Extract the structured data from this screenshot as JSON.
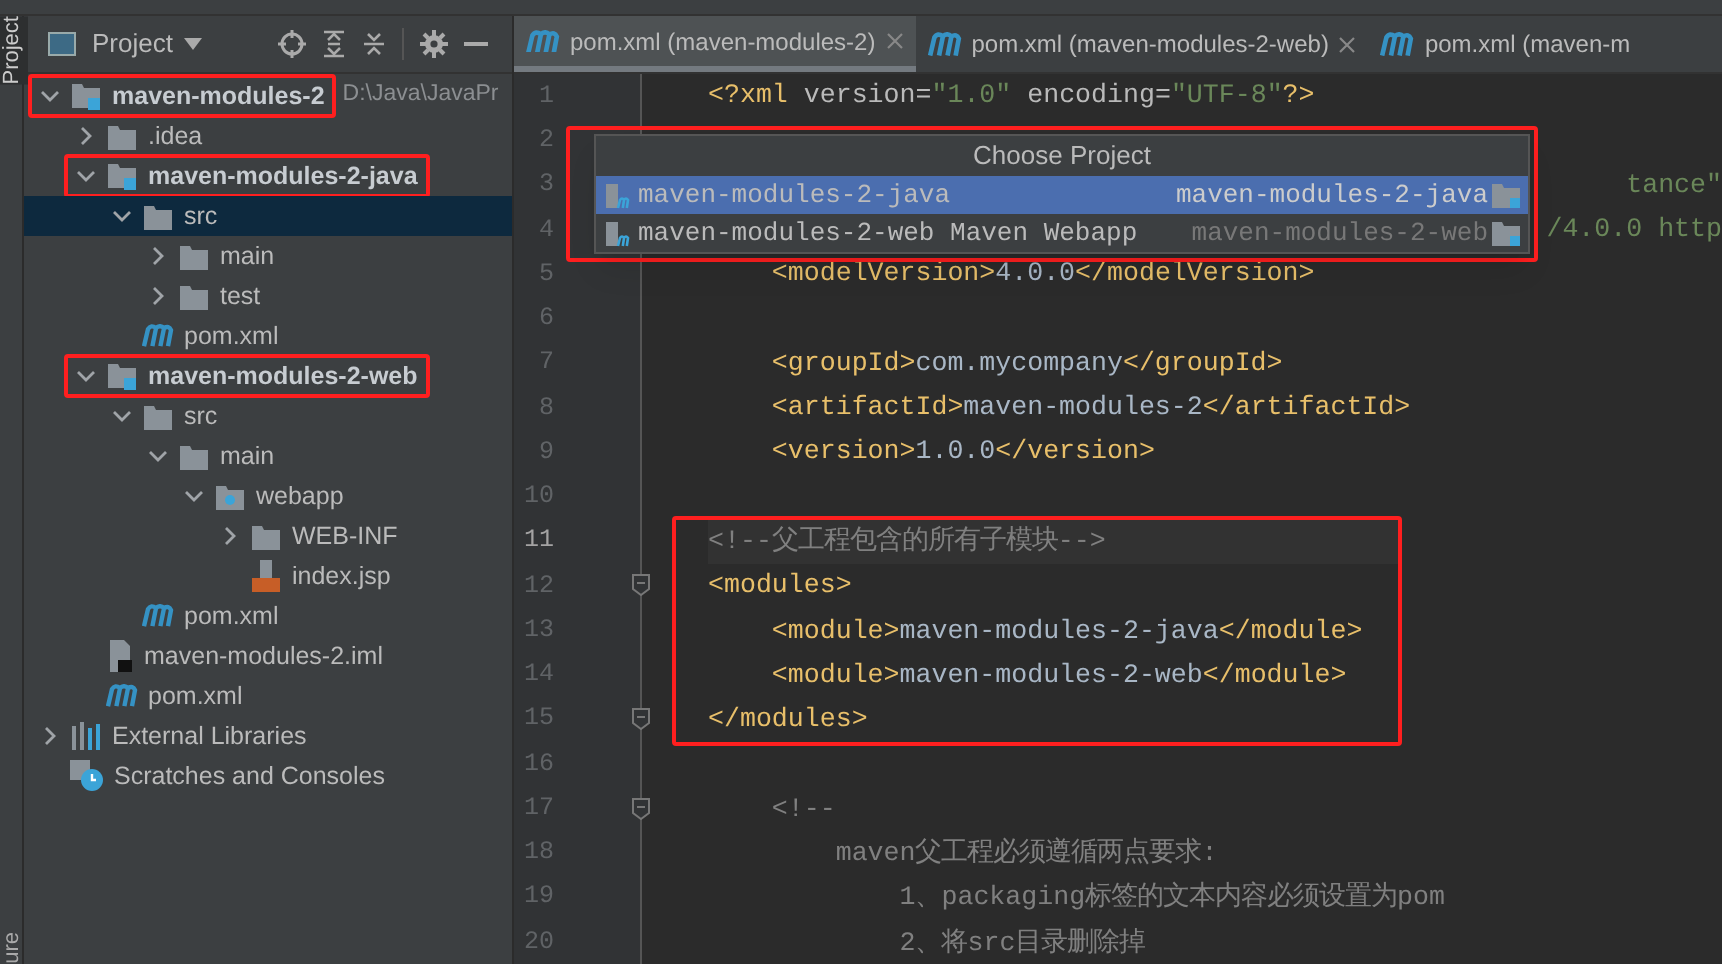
{
  "side_strip": {
    "top_tab": "Project",
    "bottom_tab": "ure"
  },
  "project_panel": {
    "title": "Project",
    "tree": [
      {
        "name": "maven-modules-2",
        "kind": "module",
        "path": "D:\\Java\\JavaPr",
        "expanded": true,
        "selected": false,
        "annotated": true,
        "children": [
          {
            "name": ".idea",
            "kind": "folder",
            "expanded": false,
            "selected": false,
            "annotated": false
          },
          {
            "name": "maven-modules-2-java",
            "kind": "module",
            "expanded": true,
            "selected": false,
            "annotated": true,
            "children": [
              {
                "name": "src",
                "kind": "folder",
                "expanded": true,
                "selected": true,
                "annotated": false,
                "children": [
                  {
                    "name": "main",
                    "kind": "folder",
                    "expanded": false,
                    "selected": false,
                    "annotated": false
                  },
                  {
                    "name": "test",
                    "kind": "folder",
                    "expanded": false,
                    "selected": false,
                    "annotated": false
                  }
                ]
              },
              {
                "name": "pom.xml",
                "kind": "pom",
                "selected": false,
                "annotated": false
              }
            ]
          },
          {
            "name": "maven-modules-2-web",
            "kind": "module",
            "expanded": true,
            "selected": false,
            "annotated": true,
            "children": [
              {
                "name": "src",
                "kind": "folder",
                "expanded": true,
                "selected": false,
                "annotated": false,
                "children": [
                  {
                    "name": "main",
                    "kind": "folder",
                    "expanded": true,
                    "selected": false,
                    "annotated": false,
                    "children": [
                      {
                        "name": "webapp",
                        "kind": "webfolder",
                        "expanded": true,
                        "selected": false,
                        "annotated": false,
                        "children": [
                          {
                            "name": "WEB-INF",
                            "kind": "folder",
                            "expanded": false,
                            "selected": false,
                            "annotated": false
                          },
                          {
                            "name": "index.jsp",
                            "kind": "jsp",
                            "selected": false,
                            "annotated": false
                          }
                        ]
                      }
                    ]
                  }
                ]
              },
              {
                "name": "pom.xml",
                "kind": "pom",
                "selected": false,
                "annotated": false
              }
            ]
          },
          {
            "name": "maven-modules-2.iml",
            "kind": "iml",
            "selected": false,
            "annotated": false
          },
          {
            "name": "pom.xml",
            "kind": "pom",
            "selected": false,
            "annotated": false
          }
        ]
      },
      {
        "name": "External Libraries",
        "kind": "libraries",
        "expanded": false,
        "selected": false,
        "annotated": false
      },
      {
        "name": "Scratches and Consoles",
        "kind": "scratches",
        "selected": false,
        "annotated": false
      }
    ]
  },
  "tabs": [
    {
      "label": "pom.xml (maven-modules-2)",
      "selected": true,
      "closable": true
    },
    {
      "label": "pom.xml (maven-modules-2-web)",
      "selected": false,
      "closable": true
    },
    {
      "label": "pom.xml (maven-m",
      "selected": false,
      "closable": false
    }
  ],
  "editor": {
    "blocks": [
      {
        "annotated": false,
        "lines": [
          {
            "number": "1",
            "fold": false,
            "current": false,
            "segments": [
              {
                "text": "<?xml",
                "kind": "tag"
              },
              {
                "text": " version=",
                "kind": "attr"
              },
              {
                "text": "\"1.0\"",
                "kind": "string"
              },
              {
                "text": " encoding=",
                "kind": "attr"
              },
              {
                "text": "\"UTF-8\"",
                "kind": "string"
              },
              {
                "text": "?>",
                "kind": "tag"
              }
            ]
          },
          {
            "number": "2",
            "fold": false,
            "current": false
          },
          {
            "number": "3",
            "current": false,
            "tail": "tance\""
          },
          {
            "number": "4",
            "current": false,
            "tail": "/4.0.0 http"
          },
          {
            "number": "5",
            "fold": false,
            "current": false,
            "segments": [
              {
                "text": "    <modelVersion>",
                "kind": "tag"
              },
              {
                "text": "4.0.0",
                "kind": "text"
              },
              {
                "text": "</modelVersion>",
                "kind": "tag"
              }
            ]
          },
          {
            "number": "6",
            "fold": false,
            "current": false
          },
          {
            "number": "7",
            "fold": false,
            "current": false,
            "segments": [
              {
                "text": "    <groupId>",
                "kind": "tag"
              },
              {
                "text": "com.mycompany",
                "kind": "text"
              },
              {
                "text": "</groupId>",
                "kind": "tag"
              }
            ]
          },
          {
            "number": "8",
            "fold": false,
            "current": false,
            "segments": [
              {
                "text": "    <artifactId>",
                "kind": "tag"
              },
              {
                "text": "maven-modules-2",
                "kind": "text"
              },
              {
                "text": "</artifactId>",
                "kind": "tag"
              }
            ]
          },
          {
            "number": "9",
            "fold": false,
            "current": false,
            "segments": [
              {
                "text": "    <version>",
                "kind": "tag"
              },
              {
                "text": "1.0.0",
                "kind": "text"
              },
              {
                "text": "</version>",
                "kind": "tag"
              }
            ]
          },
          {
            "number": "10",
            "fold": false,
            "current": false
          }
        ]
      },
      {
        "annotated": true,
        "lines": [
          {
            "number": "11",
            "fold": false,
            "current": true,
            "segments": [
              {
                "text": "<!--父工程包含的所有子模块-->",
                "kind": "comment"
              }
            ]
          },
          {
            "number": "12",
            "fold": true,
            "current": false,
            "segments": [
              {
                "text": "<modules>",
                "kind": "tag"
              }
            ]
          },
          {
            "number": "13",
            "fold": false,
            "current": false,
            "segments": [
              {
                "text": "    <module>",
                "kind": "tag"
              },
              {
                "text": "maven-modules-2-java",
                "kind": "text"
              },
              {
                "text": "</module>",
                "kind": "tag"
              }
            ]
          },
          {
            "number": "14",
            "fold": false,
            "current": false,
            "segments": [
              {
                "text": "    <module>",
                "kind": "tag"
              },
              {
                "text": "maven-modules-2-web",
                "kind": "text"
              },
              {
                "text": "</module>",
                "kind": "tag"
              }
            ]
          },
          {
            "number": "15",
            "fold": true,
            "current": false,
            "segments": [
              {
                "text": "</modules>",
                "kind": "tag"
              }
            ]
          }
        ]
      },
      {
        "annotated": false,
        "lines": [
          {
            "number": "16",
            "fold": false,
            "current": false
          },
          {
            "number": "17",
            "fold": true,
            "current": false,
            "segments": [
              {
                "text": "    <!--",
                "kind": "comment"
              }
            ]
          },
          {
            "number": "18",
            "fold": false,
            "current": false,
            "segments": [
              {
                "text": "        maven父工程必须遵循两点要求:",
                "kind": "comment"
              }
            ]
          },
          {
            "number": "19",
            "fold": false,
            "current": false,
            "segments": [
              {
                "text": "            1、packaging标签的文本内容必须设置为pom",
                "kind": "comment"
              }
            ]
          },
          {
            "number": "20",
            "fold": false,
            "current": false,
            "segments": [
              {
                "text": "            2、将src目录删除掉",
                "kind": "comment"
              }
            ]
          }
        ]
      }
    ]
  },
  "popup": {
    "title": "Choose Project",
    "annotated": true,
    "items": [
      {
        "label": "maven-modules-2-java",
        "module": "maven-modules-2-java",
        "selected": true
      },
      {
        "label": "maven-modules-2-web Maven Webapp",
        "module": "maven-modules-2-web",
        "selected": false
      }
    ]
  }
}
